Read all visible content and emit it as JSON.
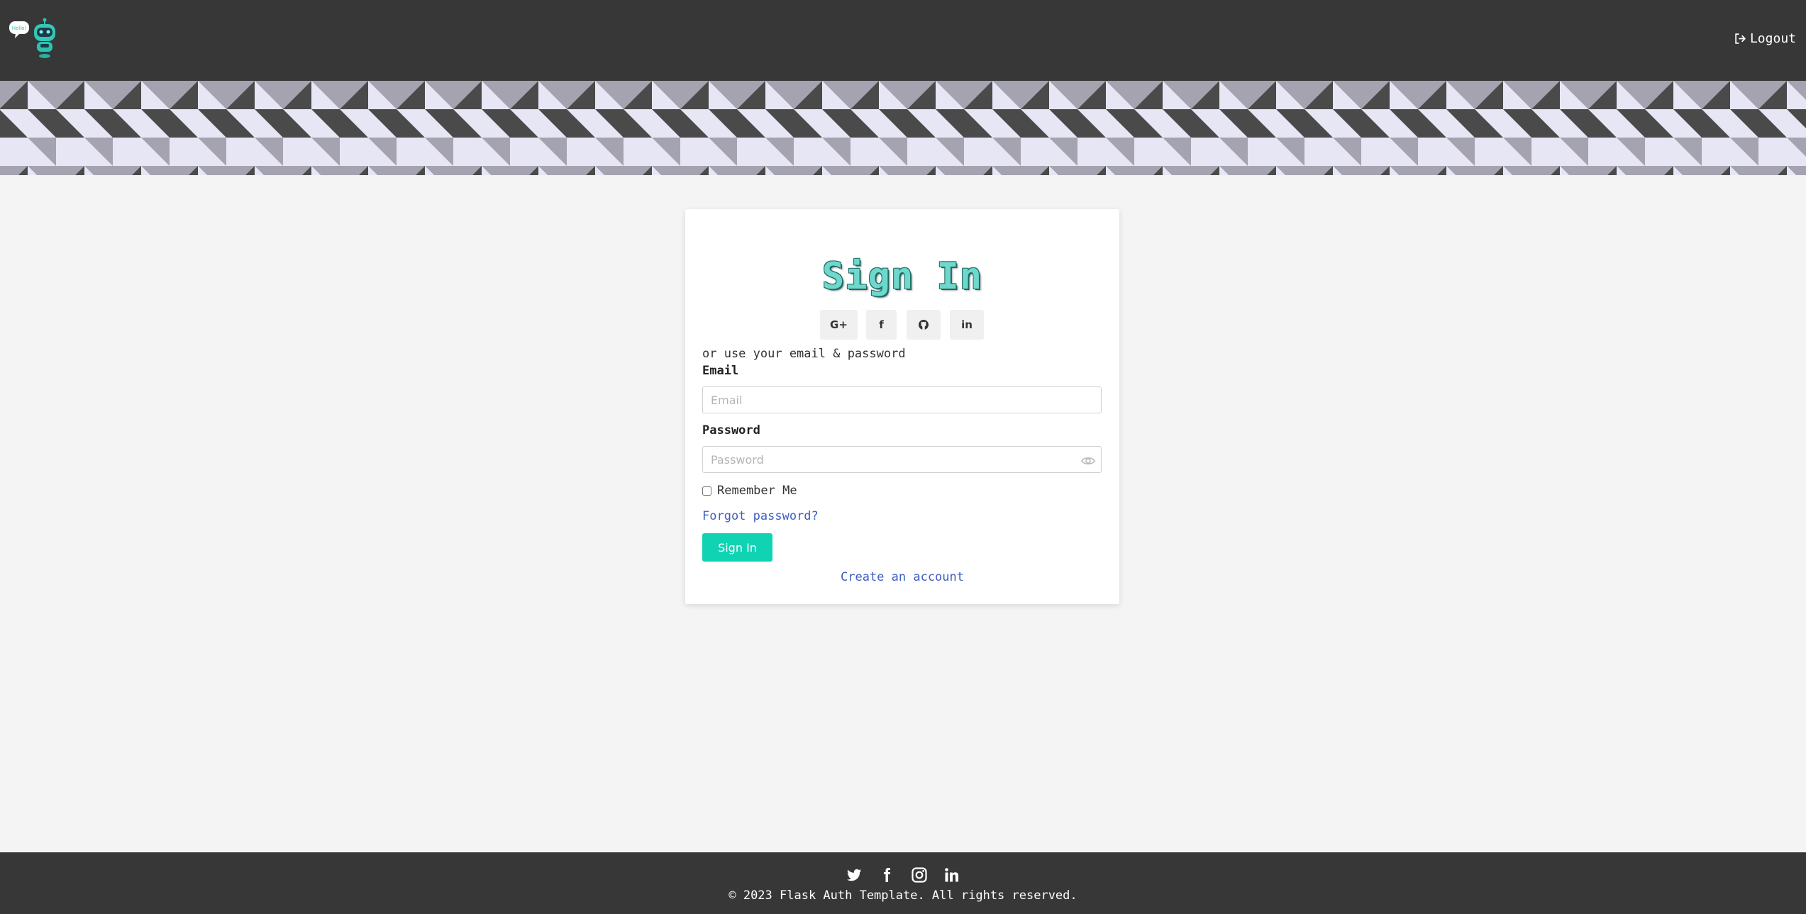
{
  "header": {
    "logo_bubble_text": "Hello!",
    "logout_label": "Logout"
  },
  "card": {
    "title": "Sign In",
    "social_buttons": [
      {
        "name": "google",
        "label": "G+"
      },
      {
        "name": "facebook",
        "label": "f"
      },
      {
        "name": "github",
        "label": ""
      },
      {
        "name": "linkedin",
        "label": "in"
      }
    ],
    "hint": "or use your email & password",
    "email_label": "Email",
    "email_placeholder": "Email",
    "email_value": "",
    "password_label": "Password",
    "password_placeholder": "Password",
    "password_value": "",
    "remember_label": "Remember Me",
    "remember_checked": false,
    "forgot_label": "Forgot password?",
    "signin_label": "Sign In",
    "create_label": "Create an account"
  },
  "footer": {
    "icons": [
      "twitter-icon",
      "facebook-icon",
      "instagram-icon",
      "linkedin-icon"
    ],
    "copyright": "© 2023 Flask Auth Template. All rights reserved."
  },
  "colors": {
    "topbar": "#373737",
    "accent": "#10d3b3",
    "link": "#3e5ec2",
    "pattern_light": "#e6e6f5",
    "pattern_mid": "#a5a3b0",
    "pattern_dark": "#4a4a4a"
  }
}
